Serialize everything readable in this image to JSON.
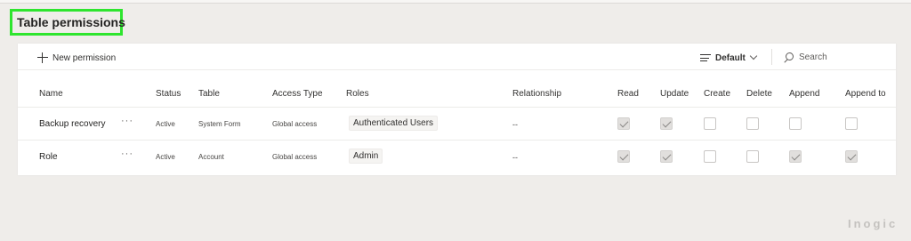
{
  "page": {
    "title": "Table permissions"
  },
  "toolbar": {
    "new_label": "New permission",
    "view_label": "Default",
    "search_placeholder": "Search"
  },
  "table": {
    "headers": [
      "Name",
      "Status",
      "Table",
      "Access Type",
      "Roles",
      "Relationship",
      "Read",
      "Update",
      "Create",
      "Delete",
      "Append",
      "Append to"
    ],
    "rows": [
      {
        "name": "Backup recovery",
        "more": "···",
        "status": "Active",
        "table": "System Form",
        "access": "Global access",
        "role": "Authenticated Users",
        "relationship": "--",
        "read": true,
        "update": true,
        "create": false,
        "delete": false,
        "append": false,
        "append_to": false
      },
      {
        "name": "Role",
        "more": "···",
        "status": "Active",
        "table": "Account",
        "access": "Global access",
        "role": "Admin",
        "relationship": "--",
        "read": true,
        "update": true,
        "create": false,
        "delete": false,
        "append": true,
        "append_to": true
      }
    ]
  },
  "watermark": "Inogic",
  "colors": {
    "highlight_border": "#2ee52e",
    "background": "#efedea"
  }
}
